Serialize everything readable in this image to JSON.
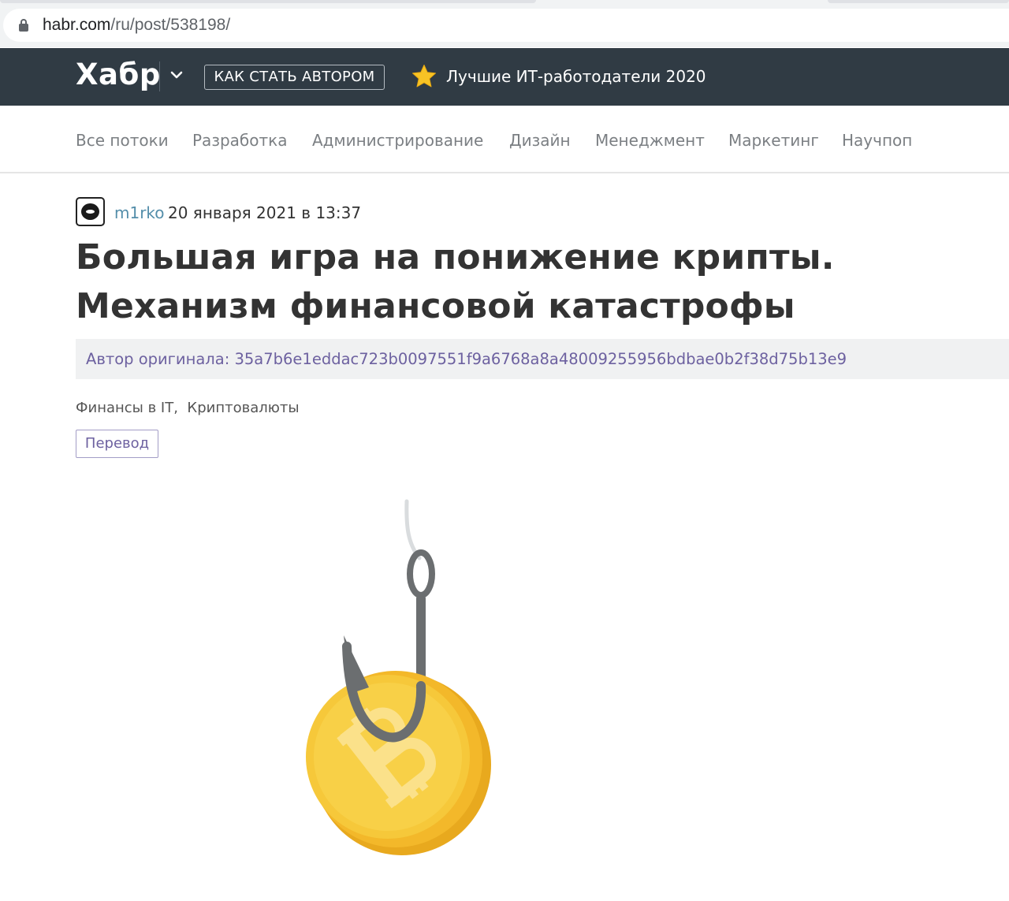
{
  "browser": {
    "url_host": "habr.com",
    "url_path": "/ru/post/538198/"
  },
  "header": {
    "logo": "Хабр",
    "author_button": "КАК СТАТЬ АВТОРОМ",
    "promo": "Лучшие ИТ-работодатели 2020",
    "icons": [
      "chevron-down-icon",
      "star-icon"
    ]
  },
  "nav": {
    "items": [
      {
        "label": "Все потоки"
      },
      {
        "label": "Разработка"
      },
      {
        "label": "Администрирование"
      },
      {
        "label": "Дизайн"
      },
      {
        "label": "Менеджмент"
      },
      {
        "label": "Маркетинг"
      },
      {
        "label": "Научпоп"
      }
    ]
  },
  "post": {
    "author": "m1rko",
    "date": "20 января 2021 в 13:37",
    "title": "Большая игра на понижение крипты. Механизм финансовой катастрофы",
    "original_author": "Автор оригинала: 35a7b6e1eddac723b0097551f9a6768a8a48009255956bdbae0b2f38d75b13e9",
    "hubs": [
      "Финансы в IT",
      "Криптовалюты"
    ],
    "hub_separator": ",",
    "badge": "Перевод"
  },
  "colors": {
    "header_bg": "#303b44",
    "link": "#548eaa",
    "translation": "#6d61a0",
    "coin": "#f5c12e"
  }
}
